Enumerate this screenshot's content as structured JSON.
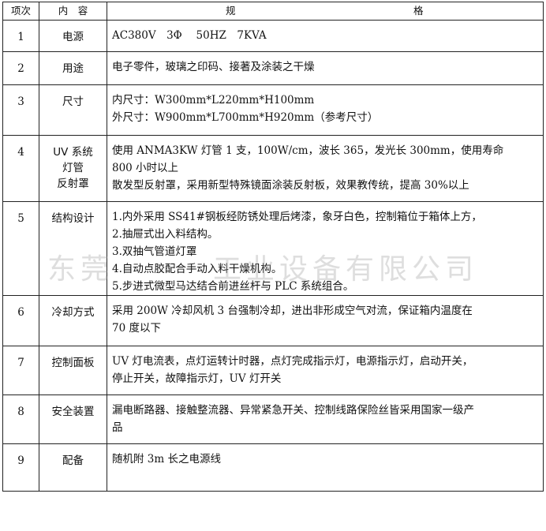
{
  "header": {
    "col_index": "项次",
    "col_item": "内　容",
    "col_spec_left": "规",
    "col_spec_right": "格"
  },
  "rows": [
    {
      "index": "1",
      "item": [
        "电源"
      ],
      "lines": [
        "AC380V　3Φ　 50HZ　7KVA"
      ]
    },
    {
      "index": "2",
      "item": [
        "用途"
      ],
      "lines": [
        "电子零件，玻璃之印码、接著及涂装之干燥"
      ]
    },
    {
      "index": "3",
      "item": [
        "尺寸"
      ],
      "lines": [
        "内尺寸：W300mm*L220mm*H100mm",
        "外尺寸：W900mm*L700mm*H920mm（参考尺寸）"
      ]
    },
    {
      "index": "4",
      "item": [
        "UV 系统",
        "灯管",
        "反射罩"
      ],
      "lines": [
        "使用 ANMA3KW 灯管 1 支，100W/cm，波长 365，发光长 300mm，使用寿命",
        "800 小时以上",
        "散发型反射罩，采用新型特殊镜面涂装反射板，效果教传统，提高 30%以上"
      ]
    },
    {
      "index": "5",
      "item": [
        "结构设计"
      ],
      "lines": [
        "1.内外采用 SS41#钢板经防锈处理后烤漆，象牙白色，控制箱位于箱体上方，",
        "2.抽屉式出入料结构。",
        "3.双抽气管道灯罩",
        "4.自动点胶配合手动入料干燥机构。",
        "5.步进式微型马达结合前进丝杆与 PLC 系统组合。"
      ]
    },
    {
      "index": "6",
      "item": [
        "冷却方式"
      ],
      "lines": [
        "采用 200W 冷却风机 3 台强制冷却，进出非形成空气对流，保证箱内温度在",
        "70 度以下"
      ]
    },
    {
      "index": "7",
      "item": [
        "控制面板"
      ],
      "lines": [
        "UV 灯电流表，点灯运转计时器，点灯完成指示灯，电源指示灯，启动开关，",
        "停止开关，故障指示灯，UV 灯开关"
      ]
    },
    {
      "index": "8",
      "item": [
        "安全装置"
      ],
      "lines": [
        "漏电断路器、接触整流器、异常紧急开关、控制线路保险丝皆采用国家一级产",
        "品"
      ]
    },
    {
      "index": "9",
      "item": [
        "配备"
      ],
      "lines": [
        "随机附 3m 长之电源线"
      ]
    }
  ],
  "watermark": "东莞　　　工业设备有限公司"
}
